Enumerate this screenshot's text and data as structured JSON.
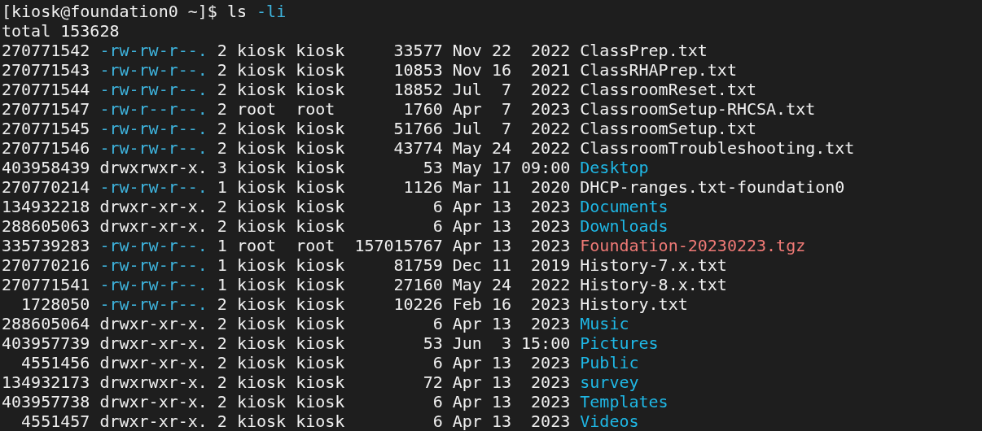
{
  "prompt": {
    "text": "[kiosk@foundation0 ~]$",
    "command": "ls",
    "argument": "-li"
  },
  "total": "total 153628",
  "rows": [
    {
      "kind": "file",
      "inode": "270771542",
      "permissions": "-rw-rw-r--.",
      "links": "2",
      "owner": "kiosk",
      "group": "kiosk",
      "size": "33577",
      "month": "Nov",
      "day": "22",
      "time": "2022",
      "name": "ClassPrep.txt"
    },
    {
      "kind": "file",
      "inode": "270771543",
      "permissions": "-rw-rw-r--.",
      "links": "2",
      "owner": "kiosk",
      "group": "kiosk",
      "size": "10853",
      "month": "Nov",
      "day": "16",
      "time": "2021",
      "name": "ClassRHAPrep.txt"
    },
    {
      "kind": "file",
      "inode": "270771544",
      "permissions": "-rw-rw-r--.",
      "links": "2",
      "owner": "kiosk",
      "group": "kiosk",
      "size": "18852",
      "month": "Jul",
      "day": "7",
      "time": "2022",
      "name": "ClassroomReset.txt"
    },
    {
      "kind": "file",
      "inode": "270771547",
      "permissions": "-rw-r--r--.",
      "links": "2",
      "owner": "root",
      "group": "root",
      "size": "1760",
      "month": "Apr",
      "day": "7",
      "time": "2023",
      "name": "ClassroomSetup-RHCSA.txt"
    },
    {
      "kind": "file",
      "inode": "270771545",
      "permissions": "-rw-rw-r--.",
      "links": "2",
      "owner": "kiosk",
      "group": "kiosk",
      "size": "51766",
      "month": "Jul",
      "day": "7",
      "time": "2022",
      "name": "ClassroomSetup.txt"
    },
    {
      "kind": "file",
      "inode": "270771546",
      "permissions": "-rw-rw-r--.",
      "links": "2",
      "owner": "kiosk",
      "group": "kiosk",
      "size": "43774",
      "month": "May",
      "day": "24",
      "time": "2022",
      "name": "ClassroomTroubleshooting.txt"
    },
    {
      "kind": "dir",
      "inode": "403958439",
      "permissions": "drwxrwxr-x.",
      "links": "3",
      "owner": "kiosk",
      "group": "kiosk",
      "size": "53",
      "month": "May",
      "day": "17",
      "time": "09:00",
      "name": "Desktop"
    },
    {
      "kind": "file",
      "inode": "270770214",
      "permissions": "-rw-rw-r--.",
      "links": "1",
      "owner": "kiosk",
      "group": "kiosk",
      "size": "1126",
      "month": "Mar",
      "day": "11",
      "time": "2020",
      "name": "DHCP-ranges.txt-foundation0"
    },
    {
      "kind": "dir",
      "inode": "134932218",
      "permissions": "drwxr-xr-x.",
      "links": "2",
      "owner": "kiosk",
      "group": "kiosk",
      "size": "6",
      "month": "Apr",
      "day": "13",
      "time": "2023",
      "name": "Documents"
    },
    {
      "kind": "dir",
      "inode": "288605063",
      "permissions": "drwxr-xr-x.",
      "links": "2",
      "owner": "kiosk",
      "group": "kiosk",
      "size": "6",
      "month": "Apr",
      "day": "13",
      "time": "2023",
      "name": "Downloads"
    },
    {
      "kind": "archive",
      "inode": "335739283",
      "permissions": "-rw-rw-r--.",
      "links": "1",
      "owner": "root",
      "group": "root",
      "size": "157015767",
      "month": "Apr",
      "day": "13",
      "time": "2023",
      "name": "Foundation-20230223.tgz"
    },
    {
      "kind": "file",
      "inode": "270770216",
      "permissions": "-rw-rw-r--.",
      "links": "1",
      "owner": "kiosk",
      "group": "kiosk",
      "size": "81759",
      "month": "Dec",
      "day": "11",
      "time": "2019",
      "name": "History-7.x.txt"
    },
    {
      "kind": "file",
      "inode": "270771541",
      "permissions": "-rw-rw-r--.",
      "links": "1",
      "owner": "kiosk",
      "group": "kiosk",
      "size": "27160",
      "month": "May",
      "day": "24",
      "time": "2022",
      "name": "History-8.x.txt"
    },
    {
      "kind": "file",
      "inode": "1728050",
      "permissions": "-rw-rw-r--.",
      "links": "2",
      "owner": "kiosk",
      "group": "kiosk",
      "size": "10226",
      "month": "Feb",
      "day": "16",
      "time": "2023",
      "name": "History.txt"
    },
    {
      "kind": "dir",
      "inode": "288605064",
      "permissions": "drwxr-xr-x.",
      "links": "2",
      "owner": "kiosk",
      "group": "kiosk",
      "size": "6",
      "month": "Apr",
      "day": "13",
      "time": "2023",
      "name": "Music"
    },
    {
      "kind": "dir",
      "inode": "403957739",
      "permissions": "drwxr-xr-x.",
      "links": "2",
      "owner": "kiosk",
      "group": "kiosk",
      "size": "53",
      "month": "Jun",
      "day": "3",
      "time": "15:00",
      "name": "Pictures"
    },
    {
      "kind": "dir",
      "inode": "4551456",
      "permissions": "drwxr-xr-x.",
      "links": "2",
      "owner": "kiosk",
      "group": "kiosk",
      "size": "6",
      "month": "Apr",
      "day": "13",
      "time": "2023",
      "name": "Public"
    },
    {
      "kind": "dir",
      "inode": "134932173",
      "permissions": "drwxrwxr-x.",
      "links": "2",
      "owner": "kiosk",
      "group": "kiosk",
      "size": "72",
      "month": "Apr",
      "day": "13",
      "time": "2023",
      "name": "survey"
    },
    {
      "kind": "dir",
      "inode": "403957738",
      "permissions": "drwxr-xr-x.",
      "links": "2",
      "owner": "kiosk",
      "group": "kiosk",
      "size": "6",
      "month": "Apr",
      "day": "13",
      "time": "2023",
      "name": "Templates"
    },
    {
      "kind": "dir",
      "inode": "4551457",
      "permissions": "drwxr-xr-x.",
      "links": "2",
      "owner": "kiosk",
      "group": "kiosk",
      "size": "6",
      "month": "Apr",
      "day": "13",
      "time": "2023",
      "name": "Videos"
    }
  ]
}
